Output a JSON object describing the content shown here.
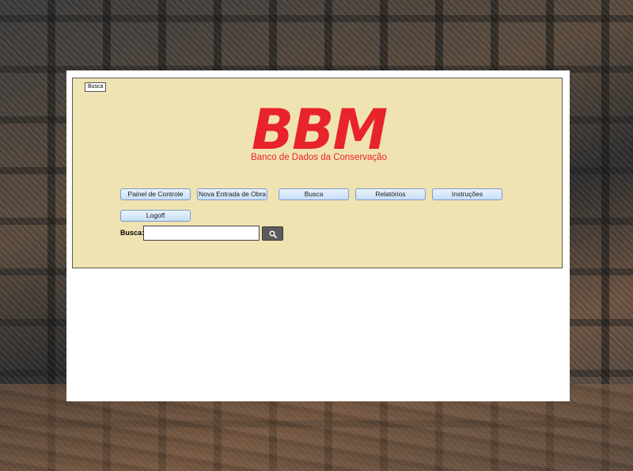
{
  "panel": {
    "legend": "Busca"
  },
  "logo": {
    "title": "BBM",
    "subtitle": "Banco de Dados da Conservação"
  },
  "nav": {
    "painel": "Painel de Controle",
    "nova_entrada": "Nova Entrada de Obra",
    "busca": "Busca",
    "relatorios": "Relatórios",
    "instrucoes": "Instruções",
    "logoff": "Logoff"
  },
  "search": {
    "label": "Busca:",
    "value": "",
    "button_icon": "search-icon"
  },
  "colors": {
    "panel_bg": "#efe3b2",
    "logo_red": "#e8232a",
    "button_gradient_top": "#eaf3fd",
    "button_gradient_bottom": "#c7ddf6",
    "search_button": "#5b5b5b"
  }
}
